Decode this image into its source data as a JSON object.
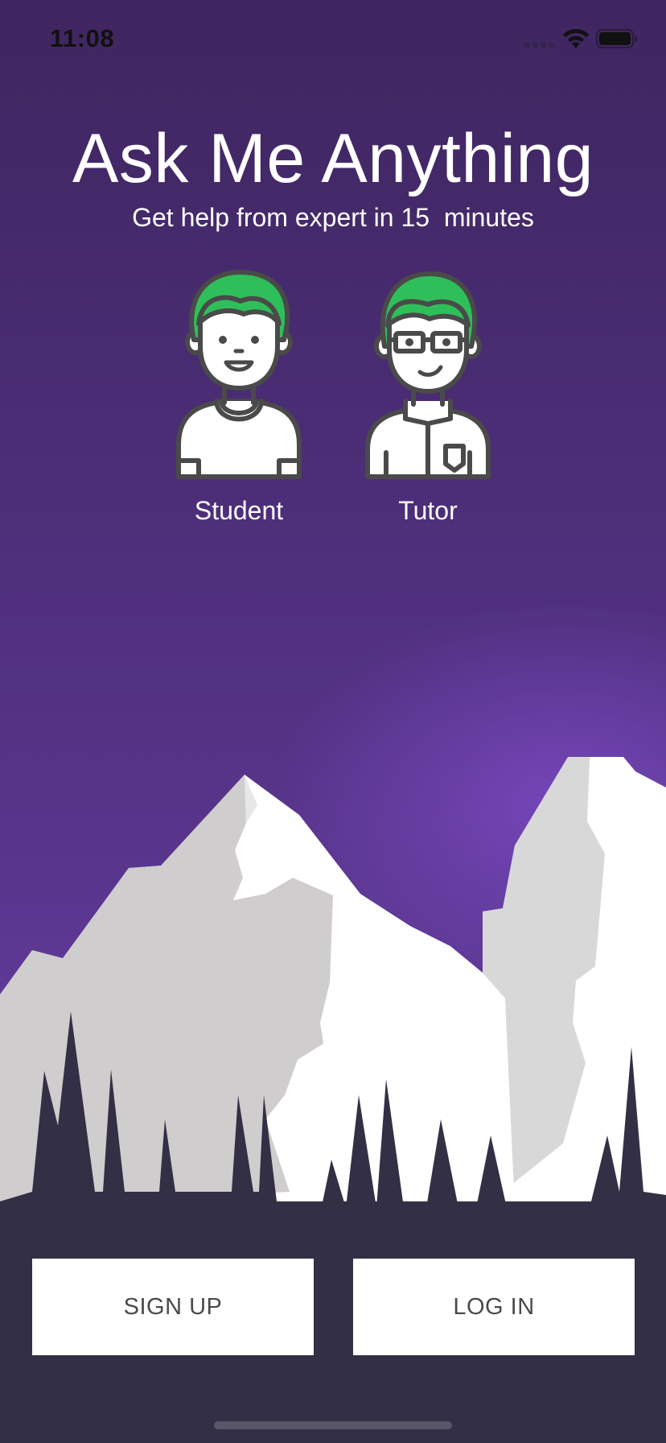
{
  "status_bar": {
    "time": "11:08",
    "icons": [
      "cellular-signal-icon",
      "wifi-icon",
      "battery-icon"
    ]
  },
  "header": {
    "title": "Ask Me Anything",
    "subtitle": "Get help from expert in 15  minutes"
  },
  "roles": [
    {
      "label": "Student",
      "icon": "student-avatar-icon"
    },
    {
      "label": "Tutor",
      "icon": "tutor-avatar-icon"
    }
  ],
  "actions": {
    "signup_label": "SIGN UP",
    "login_label": "LOG IN"
  },
  "colors": {
    "background_top": "#3f2660",
    "background_glow": "#7848be",
    "hair": "#2fbf5a",
    "ground": "#332f45",
    "button_bg": "#ffffff",
    "button_text": "#4a4a4a"
  }
}
